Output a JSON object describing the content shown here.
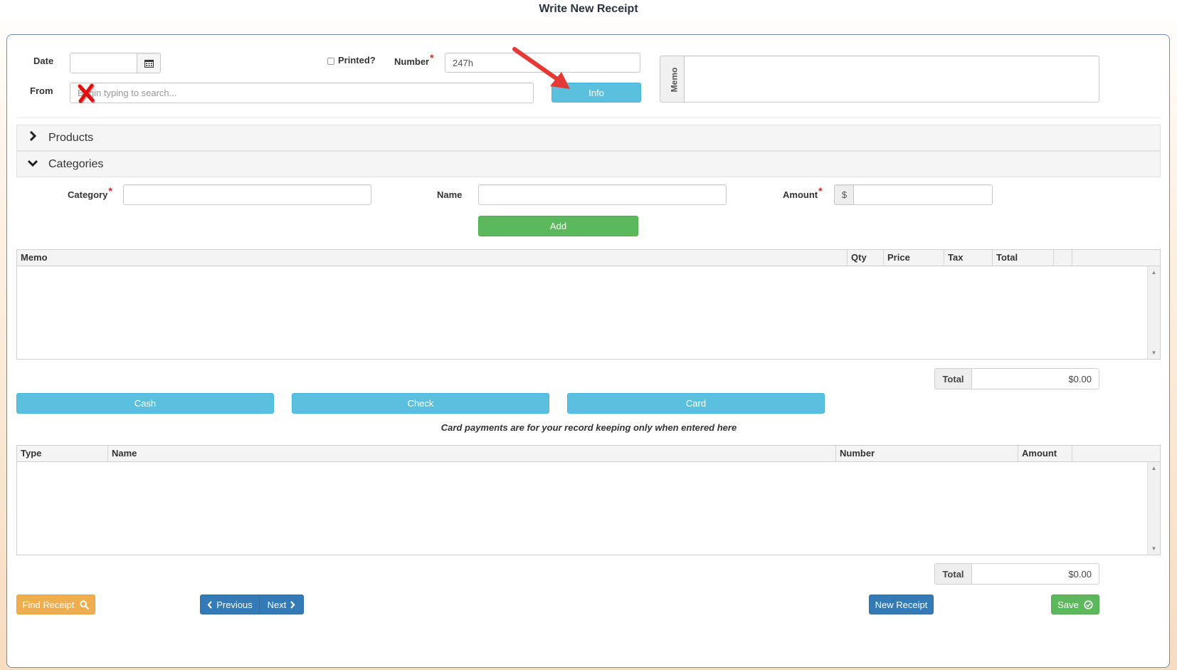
{
  "page_title": "Write New Receipt",
  "header": {
    "date_label": "Date",
    "date_value": "",
    "printed_label": "Printed?",
    "number_label": "Number",
    "number_required": "*",
    "number_value": "247h",
    "from_label": "From",
    "from_placeholder": "Begin typing to search...",
    "info_button": "Info",
    "memo_label": "Memo",
    "memo_value": ""
  },
  "sections": {
    "products": "Products",
    "categories": "Categories"
  },
  "category_form": {
    "category_label": "Category",
    "category_required": "*",
    "name_label": "Name",
    "amount_label": "Amount",
    "amount_required": "*",
    "currency_symbol": "$",
    "add_button": "Add"
  },
  "items_grid": {
    "columns": [
      "Memo",
      "Qty",
      "Price",
      "Tax",
      "Total"
    ]
  },
  "items_total": {
    "label": "Total",
    "value": "$0.00"
  },
  "payment_buttons": {
    "cash": "Cash",
    "check": "Check",
    "card": "Card"
  },
  "card_note": "Card payments are for your record keeping only when entered here",
  "payments_grid": {
    "columns": [
      "Type",
      "Name",
      "Number",
      "Amount"
    ]
  },
  "payments_total": {
    "label": "Total",
    "value": "$0.00"
  },
  "footer": {
    "find_receipt": "Find Receipt",
    "previous": "Previous",
    "next": "Next",
    "new_receipt": "New Receipt",
    "save": "Save"
  },
  "colors": {
    "info": "#5bc0de",
    "success": "#5cb85c",
    "warning": "#f0ad4e",
    "primary": "#337ab7",
    "annotation_arrow": "#e53935",
    "annotation_x": "#e01010"
  },
  "annotations": {
    "arrow_icon": "red-arrow-pointing-to-info",
    "x_icon": "red-x-mark-on-from-field"
  }
}
